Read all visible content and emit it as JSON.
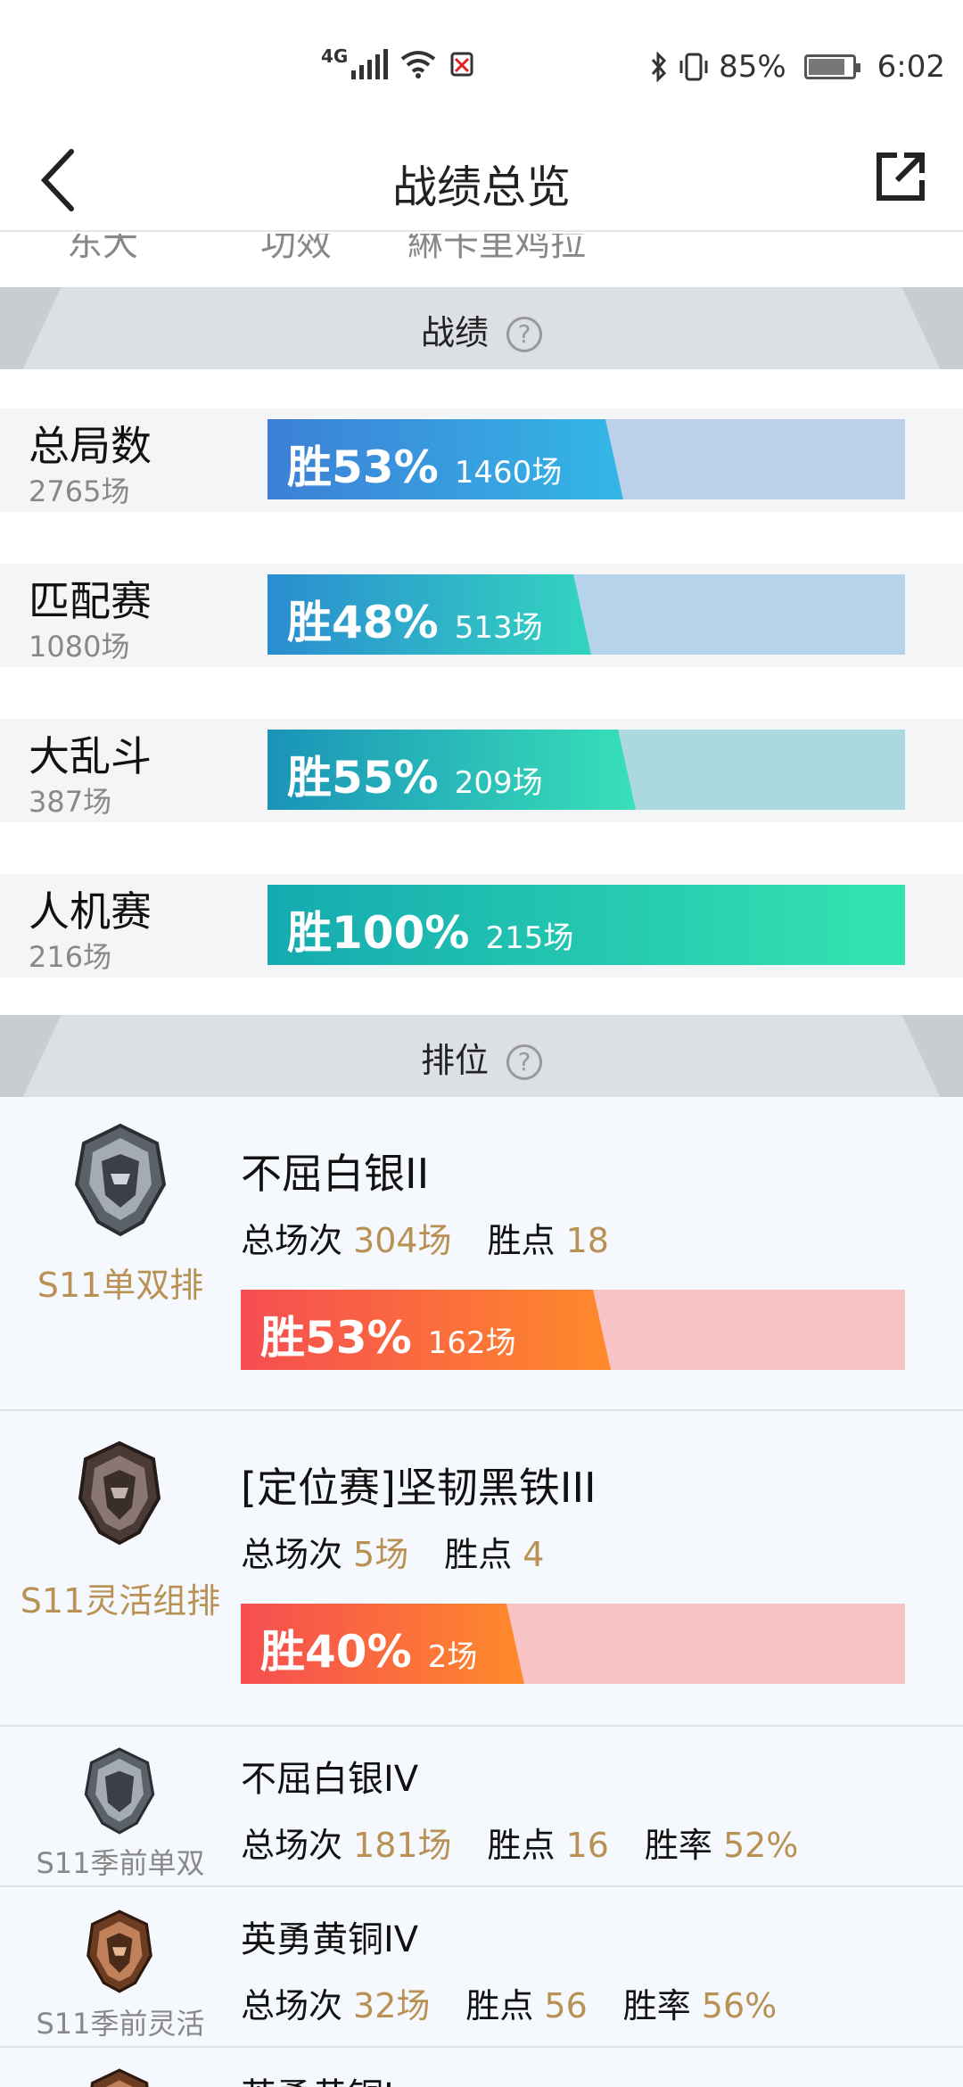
{
  "status_bar": {
    "network": "4G",
    "battery_pct": "85%",
    "time": "6:02"
  },
  "header": {
    "title": "战绩总览"
  },
  "clipped_tabs": [
    "东大",
    "功效",
    "綝卡里鸡拉"
  ],
  "sections": {
    "stats_title": "战绩",
    "ranked_title": "排位",
    "help_glyph": "?"
  },
  "stats": [
    {
      "name": "总局数",
      "total": "2765场",
      "win_label": "胜53%",
      "wins": "1460场",
      "win_rate": 0.53,
      "bar_bg": "#bcd0e9",
      "grad": [
        "#3d7fd6",
        "#33b7e6"
      ]
    },
    {
      "name": "匹配赛",
      "total": "1080场",
      "win_label": "胜48%",
      "wins": "513场",
      "win_rate": 0.48,
      "bar_bg": "#b5d3ea",
      "grad": [
        "#2a8cd1",
        "#33d4c0"
      ]
    },
    {
      "name": "大乱斗",
      "total": "387场",
      "win_label": "胜55%",
      "wins": "209场",
      "win_rate": 0.55,
      "bar_bg": "#acd8e0",
      "grad": [
        "#1a93b8",
        "#38e0b8"
      ]
    },
    {
      "name": "人机赛",
      "total": "216场",
      "win_label": "胜100%",
      "wins": "215场",
      "win_rate": 1.0,
      "bar_bg": "#a7e3d8",
      "grad": [
        "#15aab0",
        "#35e6b0"
      ]
    }
  ],
  "ranked": [
    {
      "queue": "S11单双排",
      "rank": "不屈白银II",
      "games_label": "总场次",
      "games": "304场",
      "lp_label": "胜点",
      "lp": "18",
      "win_label": "胜53%",
      "wins": "162场",
      "win_rate": 0.53,
      "emblem": "silver-emblem-icon"
    },
    {
      "queue": "S11灵活组排",
      "rank": "[定位赛]坚韧黑铁III",
      "games_label": "总场次",
      "games": "5场",
      "lp_label": "胜点",
      "lp": "4",
      "win_label": "胜40%",
      "wins": "2场",
      "win_rate": 0.4,
      "emblem": "iron-emblem-icon"
    },
    {
      "queue": "S11季前单双",
      "rank": "不屈白银IV",
      "games_label": "总场次",
      "games": "181场",
      "lp_label": "胜点",
      "lp": "16",
      "rate_label": "胜率",
      "rate": "52%",
      "emblem": "silver-emblem-icon"
    },
    {
      "queue": "S11季前灵活",
      "rank": "英勇黄铜IV",
      "games_label": "总场次",
      "games": "32场",
      "lp_label": "胜点",
      "lp": "56",
      "rate_label": "胜率",
      "rate": "56%",
      "emblem": "bronze-emblem-icon"
    },
    {
      "rank": "英勇黄铜I",
      "emblem": "bronze-emblem-icon"
    }
  ]
}
